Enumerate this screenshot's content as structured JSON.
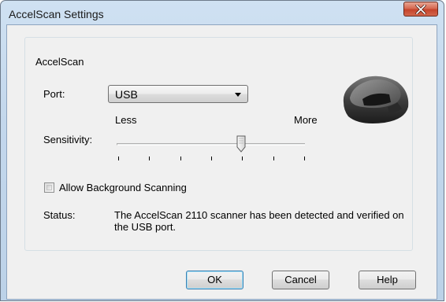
{
  "window": {
    "title": "AccelScan Settings",
    "close_icon": "close-icon"
  },
  "group": {
    "label": "AccelScan"
  },
  "port": {
    "label": "Port:",
    "value": "USB",
    "dropdown_icon": "chevron-down-icon"
  },
  "sensitivity": {
    "label": "Sensitivity:",
    "less_label": "Less",
    "more_label": "More",
    "tick_count": 7,
    "selected_tick": 4
  },
  "background_scanning": {
    "label": "Allow Background Scanning",
    "checked": false
  },
  "status": {
    "label": "Status:",
    "text": "The AccelScan 2110 scanner has been detected and verified on the USB port."
  },
  "buttons": {
    "ok": "OK",
    "cancel": "Cancel",
    "help": "Help"
  },
  "device_image": "scanner-device-image"
}
